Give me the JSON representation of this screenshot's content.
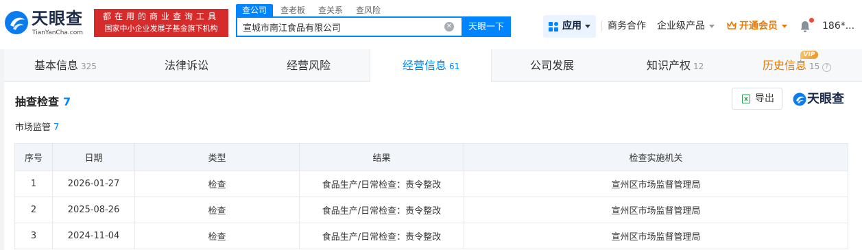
{
  "header": {
    "logo_name": "天眼查",
    "logo_domain": "TianYanCha.com",
    "slogan_line1": "都在用的商业查询工具",
    "slogan_line2": "国家中小企业发展子基金旗下机构",
    "search_tabs": [
      "查公司",
      "查老板",
      "查关系",
      "查风险"
    ],
    "search_value": "宣城市南江食品有限公司",
    "search_button": "天眼一下",
    "app_label": "应用",
    "nav": [
      "商务合作",
      "企业级产品"
    ],
    "vip_label": "开通会员",
    "user_label": "186*..."
  },
  "tabs": [
    {
      "label": "基本信息",
      "count": "325"
    },
    {
      "label": "法律诉讼",
      "count": ""
    },
    {
      "label": "经营风险",
      "count": ""
    },
    {
      "label": "经营信息",
      "count": "61"
    },
    {
      "label": "公司发展",
      "count": ""
    },
    {
      "label": "知识产权",
      "count": "12"
    },
    {
      "label": "历史信息",
      "count": "15"
    }
  ],
  "vip_badge": "VIP",
  "section": {
    "title": "抽查检查",
    "count": "7",
    "export_label": "导出",
    "brand": "天眼查",
    "sub_title": "市场监管",
    "sub_count": "7"
  },
  "table": {
    "headers": [
      "序号",
      "日期",
      "类型",
      "结果",
      "检查实施机关"
    ],
    "rows": [
      [
        "1",
        "2026-01-27",
        "检查",
        "食品生产/日常检查：责令整改",
        "宣州区市场监督管理局"
      ],
      [
        "2",
        "2025-08-26",
        "检查",
        "食品生产/日常检查：责令整改",
        "宣州区市场监督管理局"
      ],
      [
        "3",
        "2024-11-04",
        "检查",
        "食品生产/日常检查：责令整改",
        "宣州区市场监督管理局"
      ]
    ]
  },
  "colors": {
    "brand_blue": "#0084ff",
    "slogan_red": "#d62b2b",
    "vip_orange": "#e77a09"
  }
}
